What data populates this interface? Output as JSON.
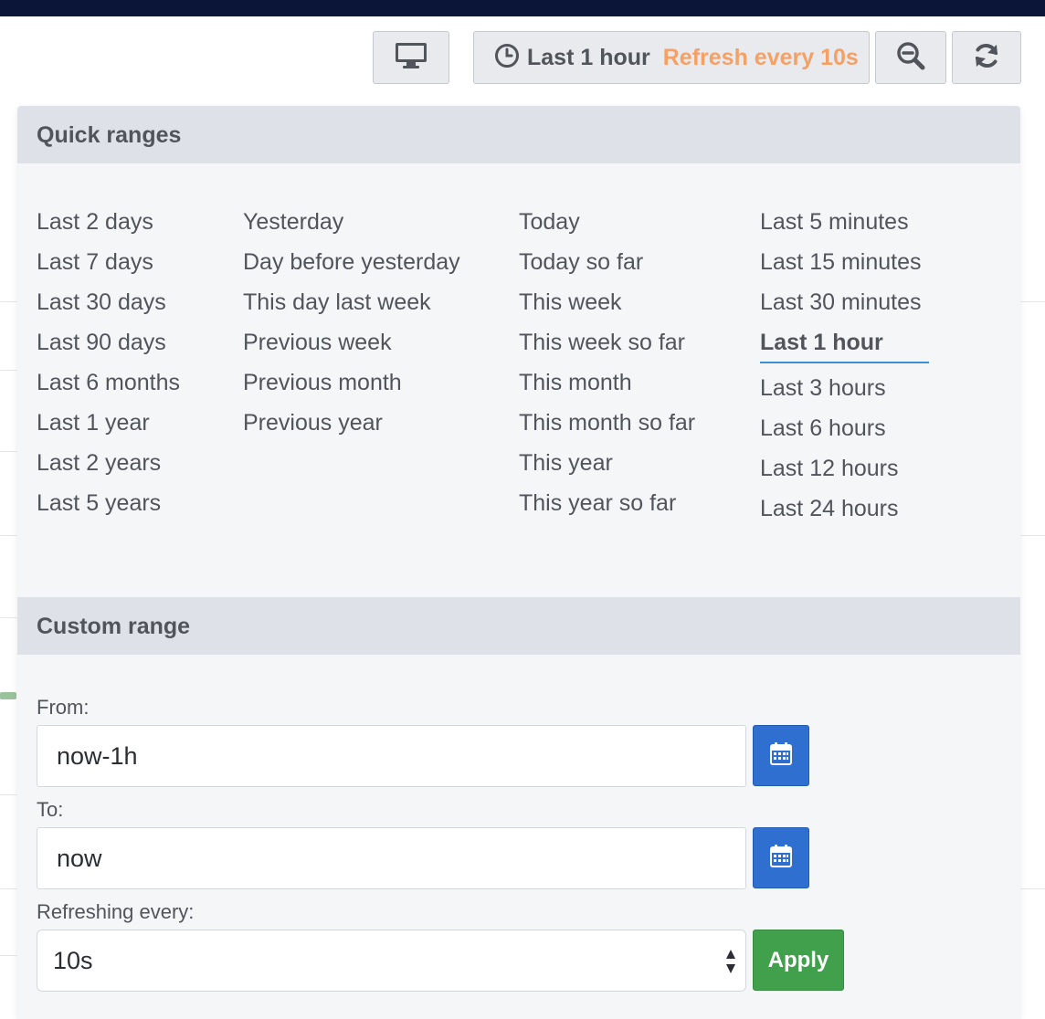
{
  "toolbar": {
    "tv_icon": "monitor-icon",
    "time_icon": "clock-icon",
    "time_label": "Last 1 hour",
    "refresh_label": "Refresh every 10s",
    "zoom_icon": "zoom-out-icon",
    "refresh_icon": "refresh-icon",
    "refresh_color": "#f5a064"
  },
  "quick_ranges": {
    "title": "Quick ranges",
    "columns": [
      [
        "Last 2 days",
        "Last 7 days",
        "Last 30 days",
        "Last 90 days",
        "Last 6 months",
        "Last 1 year",
        "Last 2 years",
        "Last 5 years"
      ],
      [
        "Yesterday",
        "Day before yesterday",
        "This day last week",
        "Previous week",
        "Previous month",
        "Previous year"
      ],
      [
        "Today",
        "Today so far",
        "This week",
        "This week so far",
        "This month",
        "This month so far",
        "This year",
        "This year so far"
      ],
      [
        "Last 5 minutes",
        "Last 15 minutes",
        "Last 30 minutes",
        "Last 1 hour",
        "Last 3 hours",
        "Last 6 hours",
        "Last 12 hours",
        "Last 24 hours"
      ]
    ],
    "active": "Last 1 hour",
    "active_color": "#3d8fd6"
  },
  "custom_range": {
    "title": "Custom range",
    "from_label": "From:",
    "from_value": "now-1h",
    "to_label": "To:",
    "to_value": "now",
    "calendar_icon": "calendar-icon",
    "refresh_label": "Refreshing every:",
    "refresh_value": "10s",
    "apply_label": "Apply",
    "apply_color": "#41a04c",
    "calendar_button_color": "#2f6fd0"
  }
}
